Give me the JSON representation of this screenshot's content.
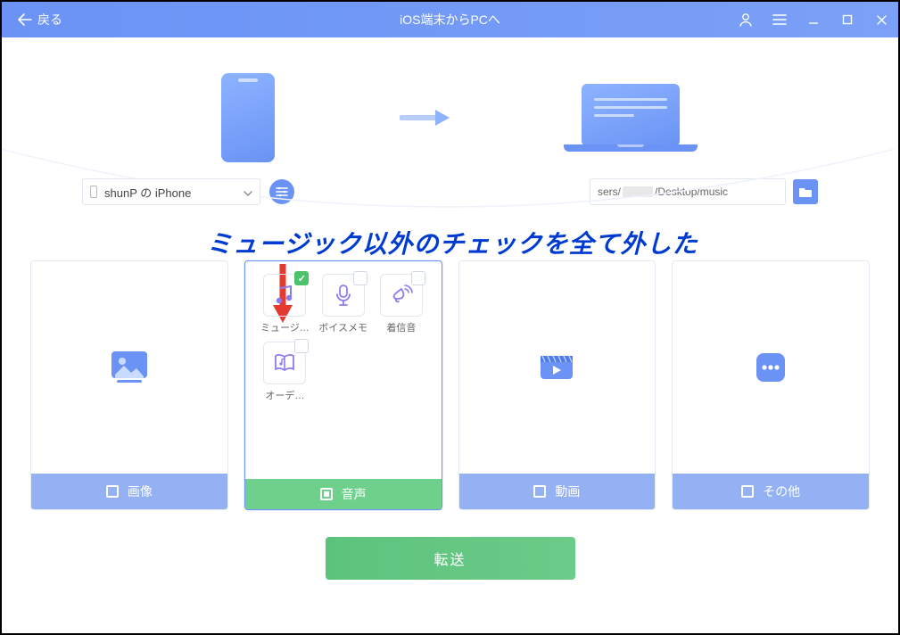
{
  "titlebar": {
    "back_label": "戻る",
    "title": "iOS端末からPCへ"
  },
  "device": {
    "name": "shunP の iPhone"
  },
  "destination": {
    "prefix": "sers/",
    "suffix": "/Desktop/music"
  },
  "annotation": {
    "text": "ミュージック以外のチェックを全て外した"
  },
  "categories": {
    "image": {
      "label": "画像"
    },
    "audio": {
      "label": "音声",
      "items": {
        "music": "ミュージ…",
        "voicememo": "ボイスメモ",
        "ringtone": "着信音",
        "audiobook": "オーデ…"
      }
    },
    "video": {
      "label": "動画"
    },
    "other": {
      "label": "その他"
    }
  },
  "transfer": {
    "label": "転送"
  }
}
